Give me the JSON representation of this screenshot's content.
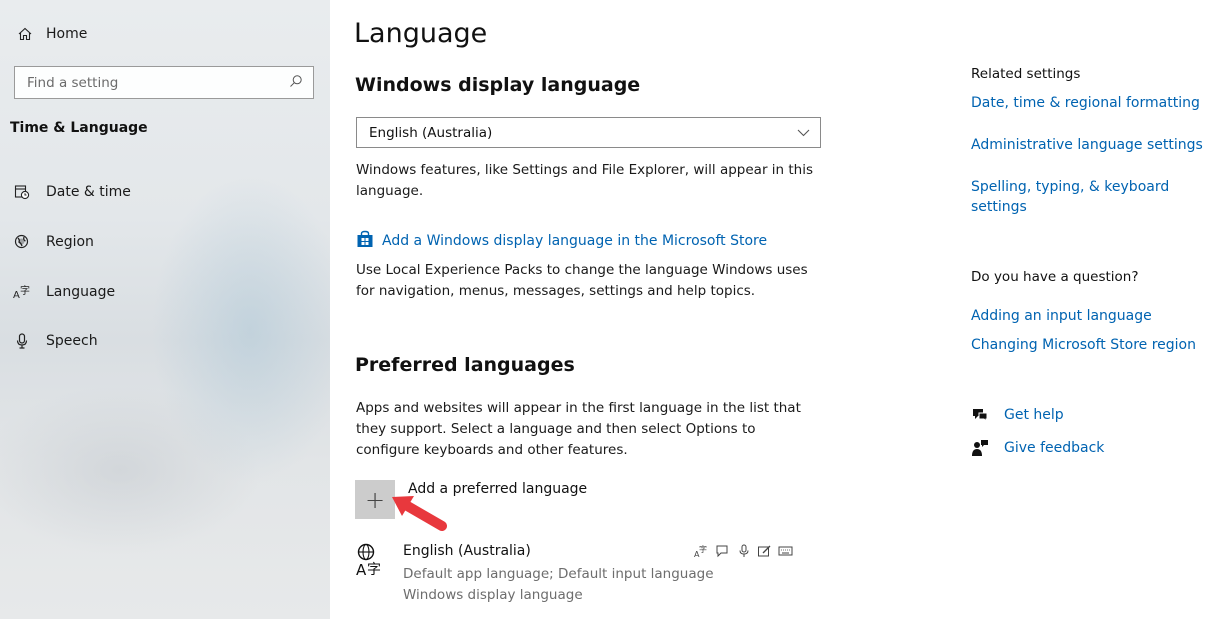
{
  "sidebar": {
    "home_label": "Home",
    "search_placeholder": "Find a setting",
    "section_title": "Time & Language",
    "items": [
      {
        "label": "Date & time",
        "icon": "calendar-clock-icon"
      },
      {
        "label": "Region",
        "icon": "globe-region-icon"
      },
      {
        "label": "Language",
        "icon": "language-icon"
      },
      {
        "label": "Speech",
        "icon": "microphone-icon"
      }
    ]
  },
  "main": {
    "title": "Language",
    "display_language": {
      "heading": "Windows display language",
      "selected": "English (Australia)",
      "description": "Windows features, like Settings and File Explorer, will appear in this language.",
      "store_link": "Add a Windows display language in the Microsoft Store",
      "store_description": "Use Local Experience Packs to change the language Windows uses for navigation, menus, messages, settings and help topics."
    },
    "preferred": {
      "heading": "Preferred languages",
      "description": "Apps and websites will appear in the first language in the list that they support. Select a language and then select Options to configure keyboards and other features.",
      "add_label": "Add a preferred language",
      "add_symbol": "+",
      "languages": [
        {
          "name": "English (Australia)",
          "meta_line1": "Default app language; Default input language",
          "meta_line2": "Windows display language"
        }
      ]
    }
  },
  "right": {
    "related_heading": "Related settings",
    "related_links": [
      "Date, time & regional formatting",
      "Administrative language settings",
      "Spelling, typing, & keyboard settings"
    ],
    "question_heading": "Do you have a question?",
    "question_links": [
      "Adding an input language",
      "Changing Microsoft Store region"
    ],
    "help_label": "Get help",
    "feedback_label": "Give feedback"
  },
  "colors": {
    "link": "#0063b1",
    "annotation_arrow": "#e8383d",
    "add_button_bg": "#cccccc"
  }
}
